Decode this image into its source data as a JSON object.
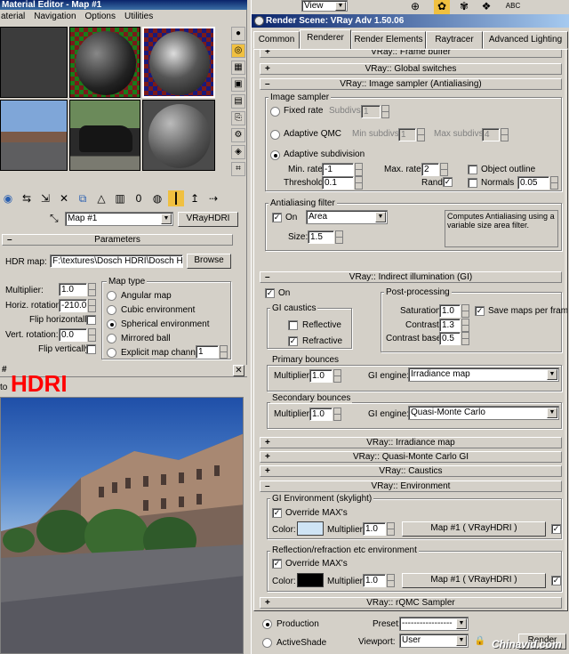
{
  "material_editor": {
    "title": "Material Editor - Map #1",
    "menu": [
      "aterial",
      "Navigation",
      "Options",
      "Utilities"
    ],
    "map_name": "Map #1",
    "map_type_button": "VRayHDRI",
    "parameters_title": "Parameters",
    "hdr_map_label": "HDR map:",
    "hdr_map_path": "F:\\textures\\Dosch HDRI\\Dosch HDR",
    "browse_label": "Browse",
    "multiplier_label": "Multiplier:",
    "multiplier_value": "1.0",
    "horiz_rotation_label": "Horiz. rotation:",
    "horiz_rotation_value": "-210.0",
    "flip_horiz_label": "Flip horizontally",
    "vert_rotation_label": "Vert. rotation:",
    "vert_rotation_value": "0.0",
    "flip_vert_label": "Flip vertically",
    "map_type_group": "Map type",
    "map_types": [
      "Angular map",
      "Cubic environment",
      "Spherical environment",
      "Mirrored ball",
      "Explicit map channel"
    ],
    "map_type_selected": 2,
    "map_channel_value": "1"
  },
  "hdri_viewer": {
    "title": "#",
    "overlay_label": "HDRI",
    "toolbar_label": "to"
  },
  "render_scene": {
    "top_view_label": "View",
    "title": "Render Scene: VRay Adv 1.50.06",
    "tabs": [
      "Common",
      "Renderer",
      "Render Elements",
      "Raytracer",
      "Advanced Lighting"
    ],
    "active_tab": 1,
    "rollouts": {
      "frame_buffer": "VRay:: Frame buffer",
      "global_switches": "VRay:: Global switches",
      "image_sampler": "VRay:: Image sampler (Antialiasing)",
      "indirect_illumination": "VRay:: Indirect illumination (GI)",
      "irradiance_map": "VRay:: Irradiance map",
      "qmc_gi": "VRay:: Quasi-Monte Carlo GI",
      "caustics": "VRay:: Caustics",
      "environment": "VRay:: Environment",
      "rqmc_sampler": "VRay:: rQMC Sampler"
    },
    "image_sampler": {
      "group_title": "Image sampler",
      "fixed_rate": "Fixed rate",
      "subdivs_label": "Subdivs:",
      "subdivs_value": "1",
      "adaptive_qmc": "Adaptive QMC",
      "min_subdivs_label": "Min subdivs:",
      "min_subdivs_value": "1",
      "max_subdivs_label": "Max subdivs:",
      "max_subdivs_value": "4",
      "adaptive_subdivision": "Adaptive subdivision",
      "min_rate_label": "Min. rate:",
      "min_rate_value": "-1",
      "max_rate_label": "Max. rate:",
      "max_rate_value": "2",
      "object_outline": "Object outline",
      "threshold_label": "Threshold:",
      "threshold_value": "0.1",
      "rand_label": "Rand",
      "normals_label": "Normals",
      "normals_value": "0.05"
    },
    "aa_filter": {
      "group_title": "Antialiasing filter",
      "on_label": "On",
      "filter_value": "Area",
      "description": "Computes Antialiasing using a variable size area filter.",
      "size_label": "Size:",
      "size_value": "1.5"
    },
    "gi": {
      "on_label": "On",
      "caustics_group": "GI caustics",
      "reflective": "Reflective",
      "refractive": "Refractive",
      "post_group": "Post-processing",
      "saturation_label": "Saturation:",
      "saturation_value": "1.0",
      "save_maps_label": "Save maps per frame",
      "contrast_label": "Contrast:",
      "contrast_value": "1.3",
      "contrast_base_label": "Contrast base:",
      "contrast_base_value": "0.5",
      "primary_group": "Primary bounces",
      "primary_multiplier_label": "Multiplier:",
      "primary_multiplier_value": "1.0",
      "primary_engine_label": "GI engine:",
      "primary_engine_value": "Irradiance map",
      "secondary_group": "Secondary bounces",
      "secondary_multiplier_label": "Multiplier:",
      "secondary_multiplier_value": "1.0",
      "secondary_engine_label": "GI engine:",
      "secondary_engine_value": "Quasi-Monte Carlo"
    },
    "environment": {
      "skylight_group": "GI Environment (skylight)",
      "override1_label": "Override MAX's",
      "color1_label": "Color:",
      "color1": "#cfe4f5",
      "multiplier1_label": "Multiplier:",
      "multiplier1_value": "1.0",
      "map1_label": "Map #1  ( VRayHDRI )",
      "reflect_group": "Reflection/refraction etc environment",
      "override2_label": "Override MAX's",
      "color2_label": "Color:",
      "color2": "#000000",
      "multiplier2_label": "Multiplier:",
      "multiplier2_value": "1.0",
      "map2_label": "Map #1  ( VRayHDRI )"
    },
    "bottom": {
      "production_label": "Production",
      "activeshade_label": "ActiveShade",
      "preset_label": "Preset:",
      "preset_value": "-----------------",
      "viewport_label": "Viewport:",
      "viewport_value": "User",
      "render_label": "Render"
    },
    "watermark": "Chinavid.com"
  },
  "colors": {
    "title_bar": "#0a246a",
    "panel": "#d4d0c8",
    "hdri_label": "#ff0000"
  }
}
